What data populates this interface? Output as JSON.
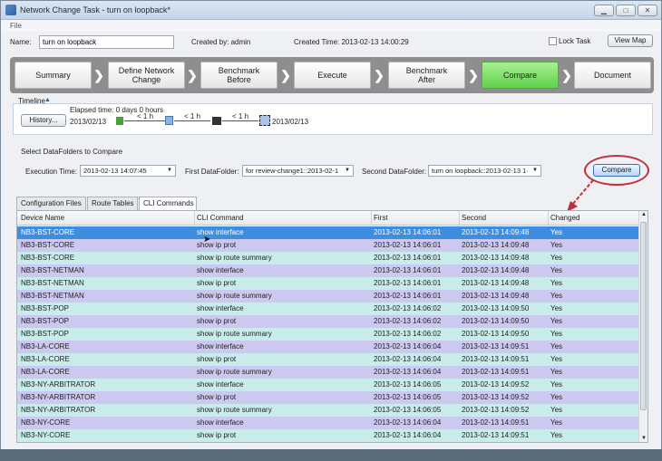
{
  "window": {
    "title": "Network Change Task - turn on loopback*",
    "minimize": "▁",
    "maximize": "□",
    "close": "✕"
  },
  "menu": {
    "file": "File"
  },
  "task": {
    "name_label": "Name:",
    "name_value": "turn on loopback",
    "created_by": "Created by: admin",
    "created_time": "Created Time: 2013-02-13 14:00:29",
    "lock_task": "Lock Task",
    "view_map": "View Map"
  },
  "steps": [
    {
      "label": "Summary",
      "active": false
    },
    {
      "label": "Define Network Change",
      "active": false
    },
    {
      "label": "Benchmark Before",
      "active": false
    },
    {
      "label": "Execute",
      "active": false
    },
    {
      "label": "Benchmark After",
      "active": false
    },
    {
      "label": "Compare",
      "active": true
    },
    {
      "label": "Document",
      "active": false
    }
  ],
  "timeline": {
    "label": "Timeline",
    "history_button": "History...",
    "elapsed": "Elapsed time: 0 days 0 hours",
    "start_date": "2013/02/13",
    "end_date": "2013/02/13",
    "seg1": "< 1 h",
    "seg2": "< 1 h",
    "seg3": "< 1 h"
  },
  "select": {
    "title": "Select DataFolders to Compare",
    "exec_label": "Execution Time:",
    "exec_value": "2013-02-13 14:07:45",
    "first_label": "First DataFolder:",
    "first_value": "for review-change1::2013-02-1",
    "second_label": "Second DataFolder:",
    "second_value": "turn on loopback::2013-02-13 1·",
    "compare_button": "Compare",
    "accent_color": "#c0303a"
  },
  "tabs": [
    "Configuration Files",
    "Route Tables",
    "CLI Commands"
  ],
  "table": {
    "columns": [
      "Device Name",
      "CLI Command",
      "First",
      "Second",
      "Changed"
    ],
    "rows": [
      [
        "NB3-BST-CORE",
        "show interface",
        "2013-02-13 14:06:01",
        "2013-02-13 14:09:48",
        "Yes"
      ],
      [
        "NB3-BST-CORE",
        "show ip prot",
        "2013-02-13 14:06:01",
        "2013-02-13 14:09:48",
        "Yes"
      ],
      [
        "NB3-BST-CORE",
        "show ip route summary",
        "2013-02-13 14:06:01",
        "2013-02-13 14:09:48",
        "Yes"
      ],
      [
        "NB3-BST-NETMAN",
        "show interface",
        "2013-02-13 14:06:01",
        "2013-02-13 14:09:48",
        "Yes"
      ],
      [
        "NB3-BST-NETMAN",
        "show ip prot",
        "2013-02-13 14:06:01",
        "2013-02-13 14:09:48",
        "Yes"
      ],
      [
        "NB3-BST-NETMAN",
        "show ip route summary",
        "2013-02-13 14:06:01",
        "2013-02-13 14:09:48",
        "Yes"
      ],
      [
        "NB3-BST-POP",
        "show interface",
        "2013-02-13 14:06:02",
        "2013-02-13 14:09:50",
        "Yes"
      ],
      [
        "NB3-BST-POP",
        "show ip prot",
        "2013-02-13 14:06:02",
        "2013-02-13 14:09:50",
        "Yes"
      ],
      [
        "NB3-BST-POP",
        "show ip route summary",
        "2013-02-13 14:06:02",
        "2013-02-13 14:09:50",
        "Yes"
      ],
      [
        "NB3-LA-CORE",
        "show interface",
        "2013-02-13 14:06:04",
        "2013-02-13 14:09:51",
        "Yes"
      ],
      [
        "NB3-LA-CORE",
        "show ip prot",
        "2013-02-13 14:06:04",
        "2013-02-13 14:09:51",
        "Yes"
      ],
      [
        "NB3-LA-CORE",
        "show ip route summary",
        "2013-02-13 14:06:04",
        "2013-02-13 14:09:51",
        "Yes"
      ],
      [
        "NB3-NY-ARBITRATOR",
        "show interface",
        "2013-02-13 14:06:05",
        "2013-02-13 14:09:52",
        "Yes"
      ],
      [
        "NB3-NY-ARBITRATOR",
        "show ip prot",
        "2013-02-13 14:06:05",
        "2013-02-13 14:09:52",
        "Yes"
      ],
      [
        "NB3-NY-ARBITRATOR",
        "show ip route summary",
        "2013-02-13 14:06:05",
        "2013-02-13 14:09:52",
        "Yes"
      ],
      [
        "NB3-NY-CORE",
        "show interface",
        "2013-02-13 14:06:04",
        "2013-02-13 14:09:51",
        "Yes"
      ],
      [
        "NB3-NY-CORE",
        "show ip prot",
        "2013-02-13 14:06:04",
        "2013-02-13 14:09:51",
        "Yes"
      ]
    ]
  }
}
